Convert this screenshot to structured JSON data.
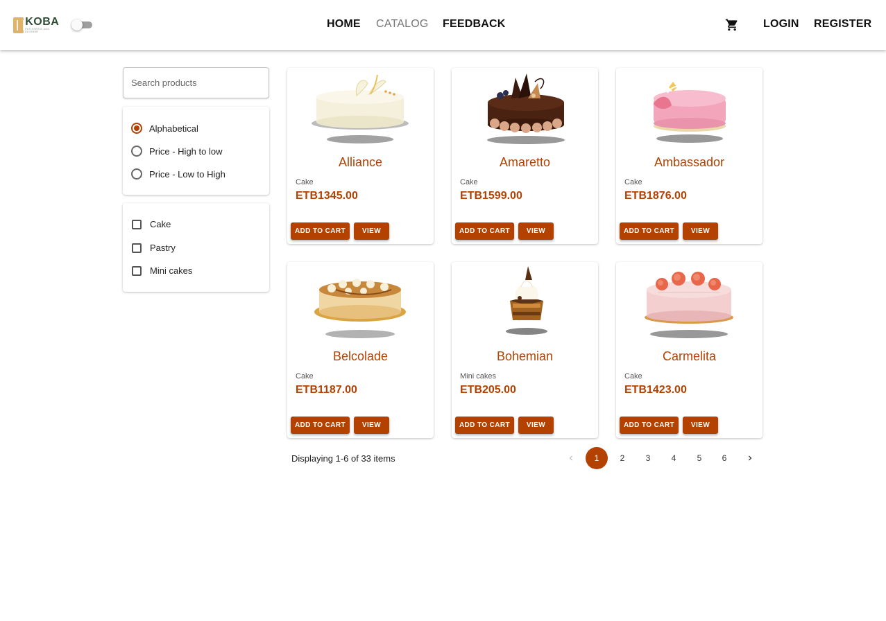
{
  "header": {
    "logo_text": "KOBA",
    "logo_tagline": "PATISSERIE AND DESSERT",
    "nav": {
      "home": "HOME",
      "catalog": "CATALOG",
      "feedback": "FEEDBACK",
      "login": "LOGIN",
      "register": "REGISTER"
    },
    "theme_toggle_on": false
  },
  "sidebar": {
    "search_placeholder": "Search products",
    "sort_options": [
      {
        "label": "Alphabetical",
        "selected": true
      },
      {
        "label": "Price - High to low",
        "selected": false
      },
      {
        "label": "Price - Low to High",
        "selected": false
      }
    ],
    "category_filters": [
      {
        "label": "Cake",
        "checked": false
      },
      {
        "label": "Pastry",
        "checked": false
      },
      {
        "label": "Mini cakes",
        "checked": false
      }
    ]
  },
  "products": [
    {
      "name": "Alliance",
      "category": "Cake",
      "price": "ETB1345.00",
      "image": "white-cake"
    },
    {
      "name": "Amaretto",
      "category": "Cake",
      "price": "ETB1599.00",
      "image": "chocolate-cake"
    },
    {
      "name": "Ambassador",
      "category": "Cake",
      "price": "ETB1876.00",
      "image": "pink-cake"
    },
    {
      "name": "Belcolade",
      "category": "Cake",
      "price": "ETB1187.00",
      "image": "caramel-cake"
    },
    {
      "name": "Bohemian",
      "category": "Mini cakes",
      "price": "ETB205.00",
      "image": "mini-cake-slice"
    },
    {
      "name": "Carmelita",
      "category": "Cake",
      "price": "ETB1423.00",
      "image": "rose-cake"
    }
  ],
  "card_buttons": {
    "add_to_cart": "ADD TO CART",
    "view": "VIEW"
  },
  "pagination": {
    "summary": "Displaying 1-6 of 33 items",
    "pages": [
      "1",
      "2",
      "3",
      "4",
      "5",
      "6"
    ],
    "current": "1"
  },
  "colors": {
    "accent": "#b34100",
    "nav_active": "#757575"
  }
}
